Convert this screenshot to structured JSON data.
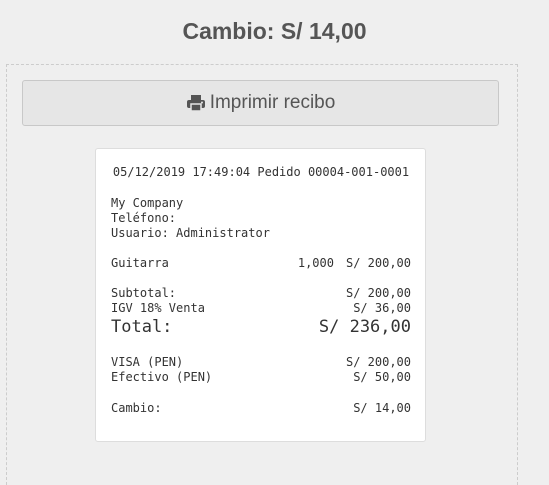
{
  "header": {
    "change_title": "Cambio: S/ 14,00"
  },
  "print_button": {
    "icon": "printer-icon",
    "label": "Imprimir recibo"
  },
  "receipt": {
    "header_line": "05/12/2019 17:49:04 Pedido 00004-001-0001",
    "company": "My Company",
    "phone_label": "Teléfono:",
    "user_line": "Usuario: Administrator",
    "items": [
      {
        "name": "Guitarra",
        "qty": "1,000",
        "price": "S/ 200,00"
      }
    ],
    "subtotal": {
      "label": "Subtotal:",
      "value": "S/ 200,00"
    },
    "tax": {
      "label": "IGV 18% Venta",
      "value": "S/ 36,00"
    },
    "total": {
      "label": "Total:",
      "value": "S/ 236,00"
    },
    "payments": [
      {
        "label": "VISA (PEN)",
        "value": "S/ 200,00"
      },
      {
        "label": "Efectivo (PEN)",
        "value": "S/ 50,00"
      }
    ],
    "change": {
      "label": "Cambio:",
      "value": "S/ 14,00"
    }
  }
}
